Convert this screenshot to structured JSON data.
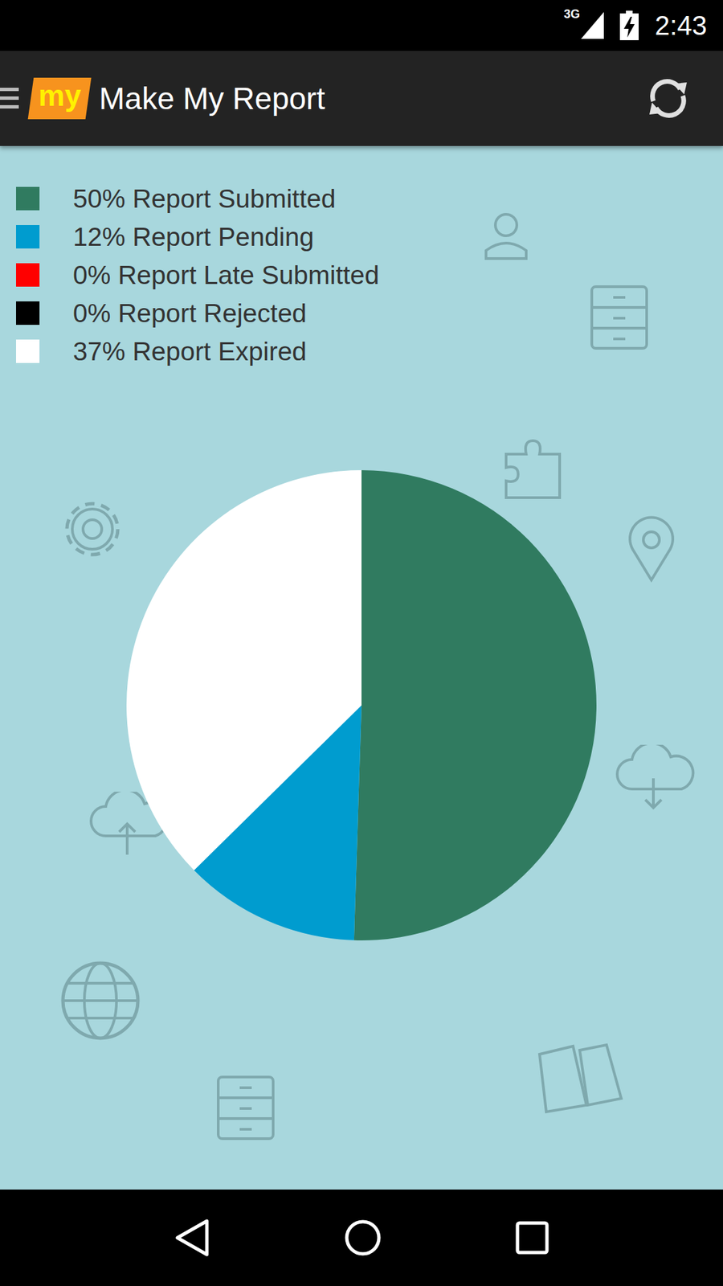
{
  "status_bar": {
    "network": "3G",
    "time": "2:43"
  },
  "app_bar": {
    "logo": "my",
    "title": "Make My Report"
  },
  "chart": {
    "slices": [
      {
        "label": "50% Report Submitted",
        "value": 50,
        "color": "#307b60"
      },
      {
        "label": "12% Report Pending",
        "value": 12,
        "color": "#009ccf"
      },
      {
        "label": "0% Report Late Submitted",
        "value": 0,
        "color": "#ff0000"
      },
      {
        "label": "0% Report Rejected",
        "value": 0,
        "color": "#000000"
      },
      {
        "label": "37% Report Expired",
        "value": 37,
        "color": "#ffffff"
      }
    ]
  }
}
